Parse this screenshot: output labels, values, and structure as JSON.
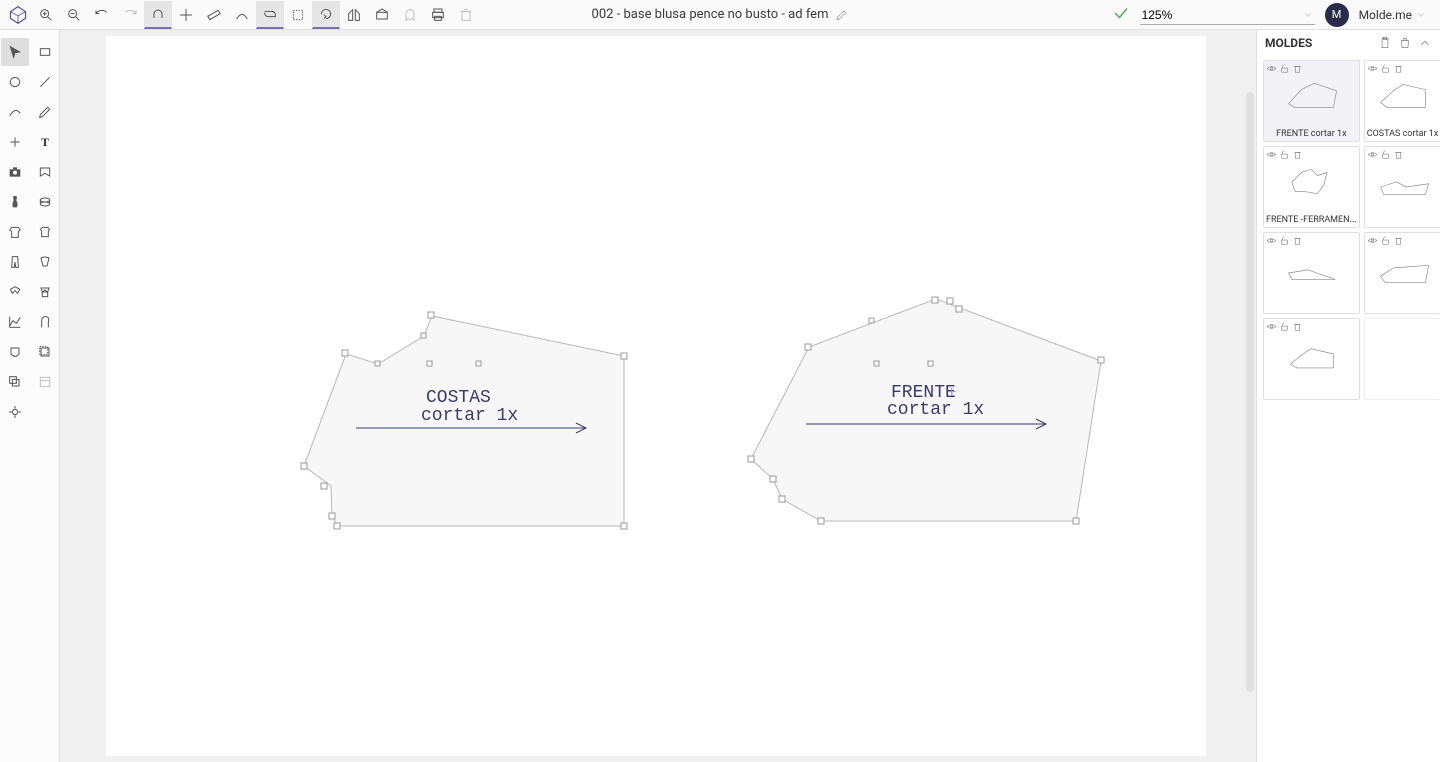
{
  "document": {
    "title": "002 - base blusa pence no busto - ad fem"
  },
  "toolbar": {
    "zoom": "125%"
  },
  "user": {
    "initial": "M",
    "name": "Molde.me"
  },
  "icons": {
    "logo": "molde-logo",
    "zoom_in": "zoom-in-icon",
    "zoom_out": "zoom-out-icon",
    "undo": "undo-icon",
    "redo": "redo-icon",
    "snap": "snap-icon",
    "crosshair": "crosshair-icon",
    "ruler": "ruler-icon",
    "curve": "curve-icon",
    "path": "path-icon",
    "select_area": "select-area-icon",
    "refresh": "refresh-icon",
    "mirror": "mirror-icon",
    "fill": "fill-icon",
    "ghost": "ghost-icon",
    "print": "print-icon",
    "trash": "trash-icon"
  },
  "left_tools": [
    {
      "name": "selection-tool",
      "active": true
    },
    {
      "name": "rectangle-tool"
    },
    {
      "name": "circle-tool"
    },
    {
      "name": "line-tool"
    },
    {
      "name": "curve-tool"
    },
    {
      "name": "pencil-tool"
    },
    {
      "name": "add-tool"
    },
    {
      "name": "text-tool"
    },
    {
      "name": "camera-tool"
    },
    {
      "name": "shape-tool"
    },
    {
      "name": "body-tool"
    },
    {
      "name": "gear-tool"
    },
    {
      "name": "shirt-tool"
    },
    {
      "name": "garment-tool"
    },
    {
      "name": "pants-tool"
    },
    {
      "name": "sleeve-tool"
    },
    {
      "name": "collar1-tool"
    },
    {
      "name": "collar2-tool"
    },
    {
      "name": "graph-tool"
    },
    {
      "name": "hood-tool"
    },
    {
      "name": "pocket-tool"
    },
    {
      "name": "seam-tool"
    },
    {
      "name": "grade-tool"
    },
    {
      "name": "marker-tool",
      "disabled": true
    },
    {
      "name": "center-tool"
    }
  ],
  "canvas": {
    "costas": {
      "title": "COSTAS",
      "sub": "cortar 1x"
    },
    "frente": {
      "title": "FRENTE",
      "sub": "cortar 1x"
    }
  },
  "right_panel": {
    "title": "MOLDES",
    "items": [
      {
        "label": "FRENTE cortar 1x",
        "selected": true
      },
      {
        "label": "COSTAS cortar 1x"
      },
      {
        "label": "FRENTE -FERRAMEN..."
      },
      {
        "label": ""
      },
      {
        "label": ""
      },
      {
        "label": ""
      },
      {
        "label": ""
      }
    ]
  }
}
